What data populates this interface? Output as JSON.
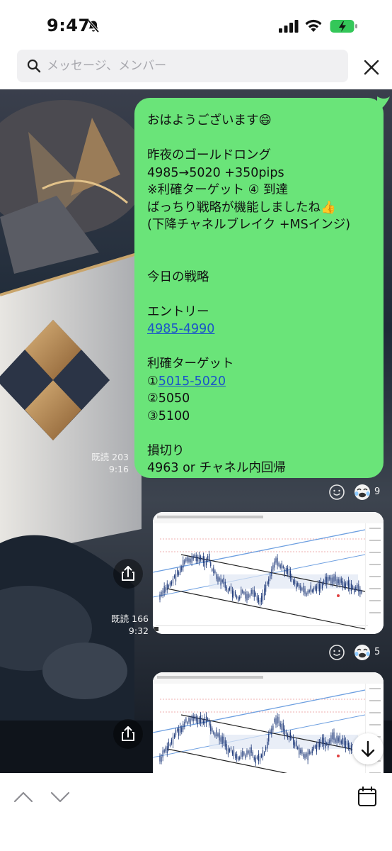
{
  "status_bar": {
    "time": "9:47",
    "icons": [
      "bell-slash-icon",
      "cellular-signal-icon",
      "wifi-icon",
      "battery-charging-icon"
    ]
  },
  "search": {
    "placeholder": "メッセージ、メンバー",
    "value": ""
  },
  "message": {
    "lines": [
      "おはようございます😄",
      "",
      "昨夜のゴールドロング",
      "4985→5020 +350pips",
      "※利確ターゲット ④ 到達",
      "ばっちり戦略が機能しましたね👍",
      "(下降チャネルブレイク +MSインジ)",
      "",
      "",
      "今日の戦略",
      "",
      "エントリー",
      "",
      "",
      "利確ターゲット",
      "",
      "②5050",
      "③5100",
      "",
      "損切り",
      "4963 or チャネル内回帰"
    ],
    "entry_link": "4985-4990",
    "target1_prefix": "①",
    "target1_link": "5015-5020",
    "read_status": "既読 203",
    "time": "9:16",
    "reaction_count": "9"
  },
  "chart_messages": [
    {
      "read_status": "既読 166",
      "time": "9:32",
      "reaction_count": "5",
      "image": "XAUUSD price chart with descending channel"
    },
    {
      "image": "XAUUSD price chart with descending channel"
    }
  ],
  "bottom_bar": {
    "icons": [
      "chevron-up-icon",
      "chevron-down-icon",
      "calendar-icon"
    ]
  },
  "colors": {
    "bubble": "#6ae479",
    "link": "#1a55c9",
    "background": "#2a3341"
  }
}
